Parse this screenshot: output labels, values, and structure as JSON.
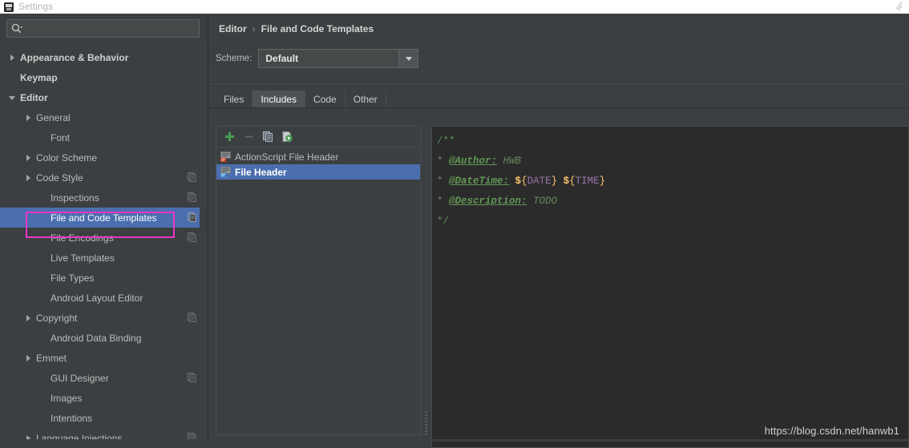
{
  "window": {
    "title": "Settings",
    "icon": "settings-window-icon"
  },
  "sidebar": {
    "search": {
      "value": "",
      "placeholder": "",
      "icon": "search-icon"
    },
    "items": [
      {
        "label": "Appearance & Behavior",
        "depth": 0,
        "arrow": "right",
        "bold": true,
        "selected": false,
        "copy_badge": false
      },
      {
        "label": "Keymap",
        "depth": 0,
        "arrow": "none",
        "bold": true,
        "selected": false,
        "copy_badge": false
      },
      {
        "label": "Editor",
        "depth": 0,
        "arrow": "down",
        "bold": true,
        "selected": false,
        "copy_badge": false
      },
      {
        "label": "General",
        "depth": 1,
        "arrow": "right",
        "bold": false,
        "selected": false,
        "copy_badge": false
      },
      {
        "label": "Font",
        "depth": 2,
        "arrow": "none",
        "bold": false,
        "selected": false,
        "copy_badge": false
      },
      {
        "label": "Color Scheme",
        "depth": 1,
        "arrow": "right",
        "bold": false,
        "selected": false,
        "copy_badge": false
      },
      {
        "label": "Code Style",
        "depth": 1,
        "arrow": "right",
        "bold": false,
        "selected": false,
        "copy_badge": true
      },
      {
        "label": "Inspections",
        "depth": 2,
        "arrow": "none",
        "bold": false,
        "selected": false,
        "copy_badge": true
      },
      {
        "label": "File and Code Templates",
        "depth": 2,
        "arrow": "none",
        "bold": false,
        "selected": true,
        "copy_badge": true
      },
      {
        "label": "File Encodings",
        "depth": 2,
        "arrow": "none",
        "bold": false,
        "selected": false,
        "copy_badge": true
      },
      {
        "label": "Live Templates",
        "depth": 2,
        "arrow": "none",
        "bold": false,
        "selected": false,
        "copy_badge": false
      },
      {
        "label": "File Types",
        "depth": 2,
        "arrow": "none",
        "bold": false,
        "selected": false,
        "copy_badge": false
      },
      {
        "label": "Android Layout Editor",
        "depth": 2,
        "arrow": "none",
        "bold": false,
        "selected": false,
        "copy_badge": false
      },
      {
        "label": "Copyright",
        "depth": 1,
        "arrow": "right",
        "bold": false,
        "selected": false,
        "copy_badge": true
      },
      {
        "label": "Android Data Binding",
        "depth": 2,
        "arrow": "none",
        "bold": false,
        "selected": false,
        "copy_badge": false
      },
      {
        "label": "Emmet",
        "depth": 1,
        "arrow": "right",
        "bold": false,
        "selected": false,
        "copy_badge": false
      },
      {
        "label": "GUI Designer",
        "depth": 2,
        "arrow": "none",
        "bold": false,
        "selected": false,
        "copy_badge": true
      },
      {
        "label": "Images",
        "depth": 2,
        "arrow": "none",
        "bold": false,
        "selected": false,
        "copy_badge": false
      },
      {
        "label": "Intentions",
        "depth": 2,
        "arrow": "none",
        "bold": false,
        "selected": false,
        "copy_badge": false
      },
      {
        "label": "Language Injections",
        "depth": 1,
        "arrow": "right",
        "bold": false,
        "selected": false,
        "copy_badge": true
      }
    ],
    "highlight_target": "File and Code Templates",
    "highlight_color": "#e936c8"
  },
  "main": {
    "breadcrumb": {
      "root": "Editor",
      "separator": "›",
      "current": "File and Code Templates"
    },
    "scheme": {
      "label": "Scheme:",
      "value": "Default"
    },
    "tabs": [
      {
        "label": "Files",
        "active": false
      },
      {
        "label": "Includes",
        "active": true
      },
      {
        "label": "Code",
        "active": false
      },
      {
        "label": "Other",
        "active": false
      }
    ],
    "list_toolbar": [
      {
        "name": "add-template-button",
        "glyph": "plus",
        "color": "#499c54",
        "enabled": true
      },
      {
        "name": "remove-template-button",
        "glyph": "minus",
        "color": "#7a7a7a",
        "enabled": false
      },
      {
        "name": "copy-template-button",
        "glyph": "copy",
        "color": "#a9b7c6",
        "enabled": true
      },
      {
        "name": "reset-template-button",
        "glyph": "reset",
        "color": "#499c54",
        "enabled": true
      }
    ],
    "templates": [
      {
        "label": "ActionScript File Header",
        "icon_color": "#cc4125",
        "selected": false
      },
      {
        "label": "File Header",
        "icon_color": "#3b8ed0",
        "selected": true
      }
    ],
    "editor": {
      "lines": [
        {
          "tokens": [
            {
              "t": "/**",
              "c": "cm"
            }
          ]
        },
        {
          "tokens": [
            {
              "t": "* ",
              "c": "cm"
            },
            {
              "t": "@Author:",
              "c": "cm-tag"
            },
            {
              "t": " HWB",
              "c": "cm-val"
            }
          ]
        },
        {
          "tokens": [
            {
              "t": "* ",
              "c": "cm"
            },
            {
              "t": "@DateTime:",
              "c": "cm-tag"
            },
            {
              "t": " ",
              "c": "cm"
            },
            {
              "t": "$",
              "c": "var-dollar"
            },
            {
              "t": "{",
              "c": "var-brace"
            },
            {
              "t": "DATE",
              "c": "var-name"
            },
            {
              "t": "}",
              "c": "var-brace"
            },
            {
              "t": " ",
              "c": "cm"
            },
            {
              "t": "$",
              "c": "var-dollar"
            },
            {
              "t": "{",
              "c": "var-brace"
            },
            {
              "t": "TIME",
              "c": "var-name"
            },
            {
              "t": "}",
              "c": "var-brace"
            }
          ]
        },
        {
          "tokens": [
            {
              "t": "* ",
              "c": "cm"
            },
            {
              "t": "@Description:",
              "c": "cm-tag"
            },
            {
              "t": " TODO",
              "c": "cm-val"
            }
          ]
        },
        {
          "tokens": [
            {
              "t": "*/",
              "c": "cm"
            }
          ]
        }
      ]
    }
  },
  "watermark": {
    "text": "https://blog.csdn.net/hanwb1"
  },
  "colors": {
    "selection_blue": "#4b6eaf",
    "highlight_magenta": "#e936c8",
    "panel_bg": "#3c3f41",
    "editor_bg": "#2b2b2b",
    "comment_green": "#629755",
    "variable_orange": "#ffc66d",
    "variable_purple": "#9876aa"
  }
}
